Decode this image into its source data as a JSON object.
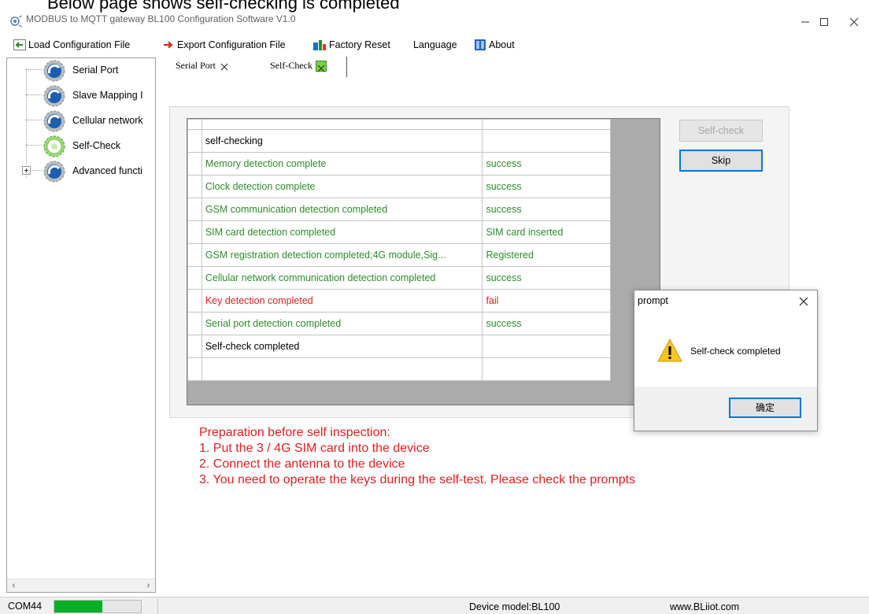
{
  "caption": "Below page shows self-checking is completed",
  "window": {
    "title": "MODBUS to MQTT gateway BL100 Configuration Software V1.0"
  },
  "menu": {
    "load": "Load Configuration File",
    "export": "Export Configuration File",
    "reset": "Factory Reset",
    "language": "Language",
    "about": "About"
  },
  "tree": {
    "items": [
      {
        "label": "Serial Port",
        "icon": "blue-gear-icon"
      },
      {
        "label": "Slave Mapping I",
        "icon": "blue-gear-icon"
      },
      {
        "label": "Cellular network",
        "icon": "blue-gear-icon"
      },
      {
        "label": "Self-Check",
        "icon": "green-gear-icon"
      },
      {
        "label": "Advanced functi",
        "icon": "blue-gear-icon"
      }
    ]
  },
  "tabs": [
    {
      "label": "Serial Port",
      "active": false
    },
    {
      "label": "Self-Check",
      "active": true
    }
  ],
  "results": {
    "rows": [
      {
        "item": "self-checking",
        "result": "",
        "status": "neutral"
      },
      {
        "item": "Memory detection complete",
        "result": "success",
        "status": "ok"
      },
      {
        "item": "Clock detection complete",
        "result": "success",
        "status": "ok"
      },
      {
        "item": "GSM communication detection completed",
        "result": "success",
        "status": "ok"
      },
      {
        "item": "SIM card detection completed",
        "result": "SIM card inserted",
        "status": "ok"
      },
      {
        "item": "GSM registration detection completed;4G module,Sig...",
        "result": "Registered",
        "status": "ok"
      },
      {
        "item": "Cellular network communication detection completed",
        "result": "success",
        "status": "ok"
      },
      {
        "item": "Key detection completed",
        "result": "fail",
        "status": "fail"
      },
      {
        "item": "Serial port detection completed",
        "result": "success",
        "status": "ok"
      },
      {
        "item": "Self-check completed",
        "result": "",
        "status": "neutral"
      },
      {
        "item": "",
        "result": "",
        "status": "neutral"
      }
    ]
  },
  "buttons": {
    "selfcheck": "Self-check",
    "skip": "Skip"
  },
  "preparation": {
    "lines": [
      "Preparation before self inspection:",
      "1. Put the 3 / 4G SIM card into the device",
      "2. Connect the antenna to the device",
      "3. You need to operate the keys during the self-test. Please check the prompts"
    ]
  },
  "dialog": {
    "title": "prompt",
    "message": "Self-check completed",
    "ok": "确定"
  },
  "status": {
    "port": "COM44",
    "progress": 0.55,
    "model": "Device model:BL100",
    "url": "www.BLiiot.com"
  },
  "colors": {
    "ok": "#2e8b2e",
    "fail": "#e02020",
    "accent": "#0078d7",
    "progress": "#06b025"
  }
}
